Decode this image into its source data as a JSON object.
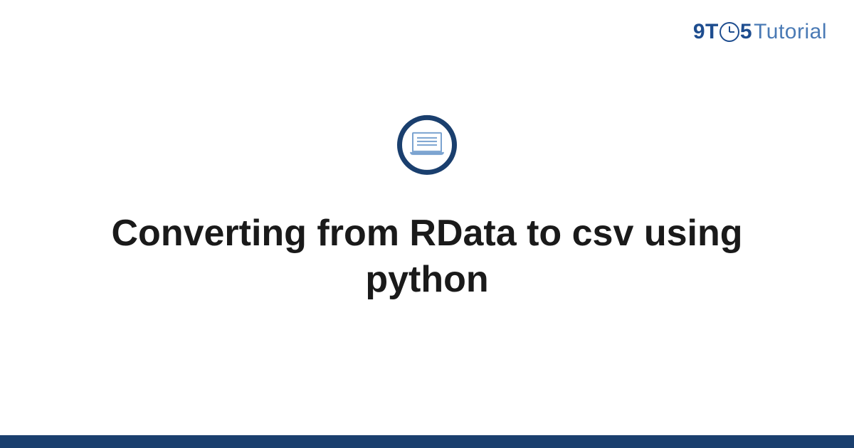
{
  "logo": {
    "prefix": "9T",
    "suffix": "5",
    "word": "Tutorial"
  },
  "title": "Converting from RData to csv using python",
  "colors": {
    "primary": "#1a3f6e",
    "logo_dark": "#1e4d8f",
    "logo_light": "#4a7ab5",
    "icon_accent": "#7ba3d0"
  }
}
